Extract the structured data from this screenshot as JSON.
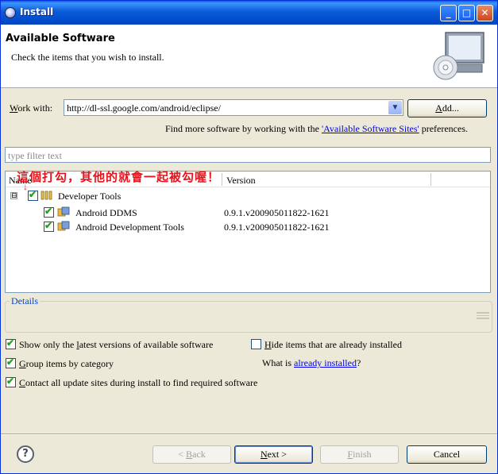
{
  "window": {
    "title": "Install",
    "minimize": "_",
    "maximize": "□",
    "close": "✕"
  },
  "header": {
    "title": "Available Software",
    "description": "Check the items that you wish to install."
  },
  "work_with": {
    "label_mnemonic": "W",
    "label_rest": "ork with:",
    "value": "http://dl-ssl.google.com/android/eclipse/",
    "add_mnemonic": "A",
    "add_rest": "dd..."
  },
  "find_more": {
    "prefix": "Find more software by working with the ",
    "link": "'Available Software Sites'",
    "suffix": " preferences."
  },
  "filter": {
    "placeholder": "type filter text"
  },
  "tree": {
    "col_name": "Name",
    "col_version": "Version",
    "annotation": "這個打勾，其他的就會一起被勾喔！",
    "expander": "⊟",
    "rows": [
      {
        "name": "Developer Tools",
        "version": "",
        "checked": true
      },
      {
        "name": "Android DDMS",
        "version": "0.9.1.v200905011822-1621",
        "checked": true
      },
      {
        "name": "Android Development Tools",
        "version": "0.9.1.v200905011822-1621",
        "checked": true
      }
    ]
  },
  "details": {
    "label": "Details"
  },
  "options": {
    "show_latest_pre": "Show only the ",
    "show_latest_mn": "l",
    "show_latest_post": "atest versions of available software",
    "show_latest_checked": true,
    "hide_installed_mn": "H",
    "hide_installed_post": "ide items that are already installed",
    "hide_installed_checked": false,
    "group_mn": "G",
    "group_post": "roup items by category",
    "group_checked": true,
    "what_is_prefix": "What is ",
    "what_is_link": "already installed",
    "what_is_suffix": "?",
    "contact_mn": "C",
    "contact_post": "ontact all update sites during install to find required software",
    "contact_checked": true
  },
  "footer": {
    "help": "?",
    "back_pre": "< ",
    "back_mn": "B",
    "back_post": "ack",
    "next_mn": "N",
    "next_post": "ext >",
    "finish_mn": "F",
    "finish_post": "inish",
    "cancel": "Cancel"
  }
}
